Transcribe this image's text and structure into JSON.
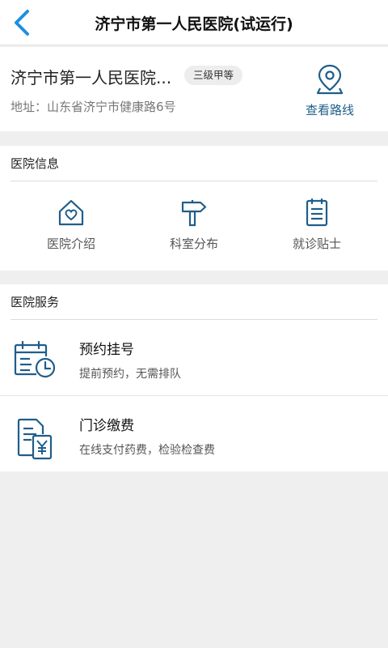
{
  "header": {
    "title": "济宁市第一人民医院(试运行)"
  },
  "hospital": {
    "name": "济宁市第一人民医院...",
    "grade_badge": "三级甲等",
    "address": "地址：山东省济宁市健康路6号",
    "route_label": "查看路线"
  },
  "info_section": {
    "title": "医院信息",
    "items": [
      {
        "label": "医院介绍",
        "icon": "house-heart-icon"
      },
      {
        "label": "科室分布",
        "icon": "signpost-icon"
      },
      {
        "label": "就诊贴士",
        "icon": "clipboard-icon"
      }
    ]
  },
  "service_section": {
    "title": "医院服务",
    "items": [
      {
        "name": "预约挂号",
        "desc": "提前预约，无需排队",
        "icon": "calendar-clock-icon"
      },
      {
        "name": "门诊缴费",
        "desc": "在线支付药费，检验检查费",
        "icon": "bill-yuan-icon"
      }
    ]
  },
  "colors": {
    "accent": "#1f8fe0",
    "icon": "#1f5e8a",
    "background": "#efefef"
  }
}
